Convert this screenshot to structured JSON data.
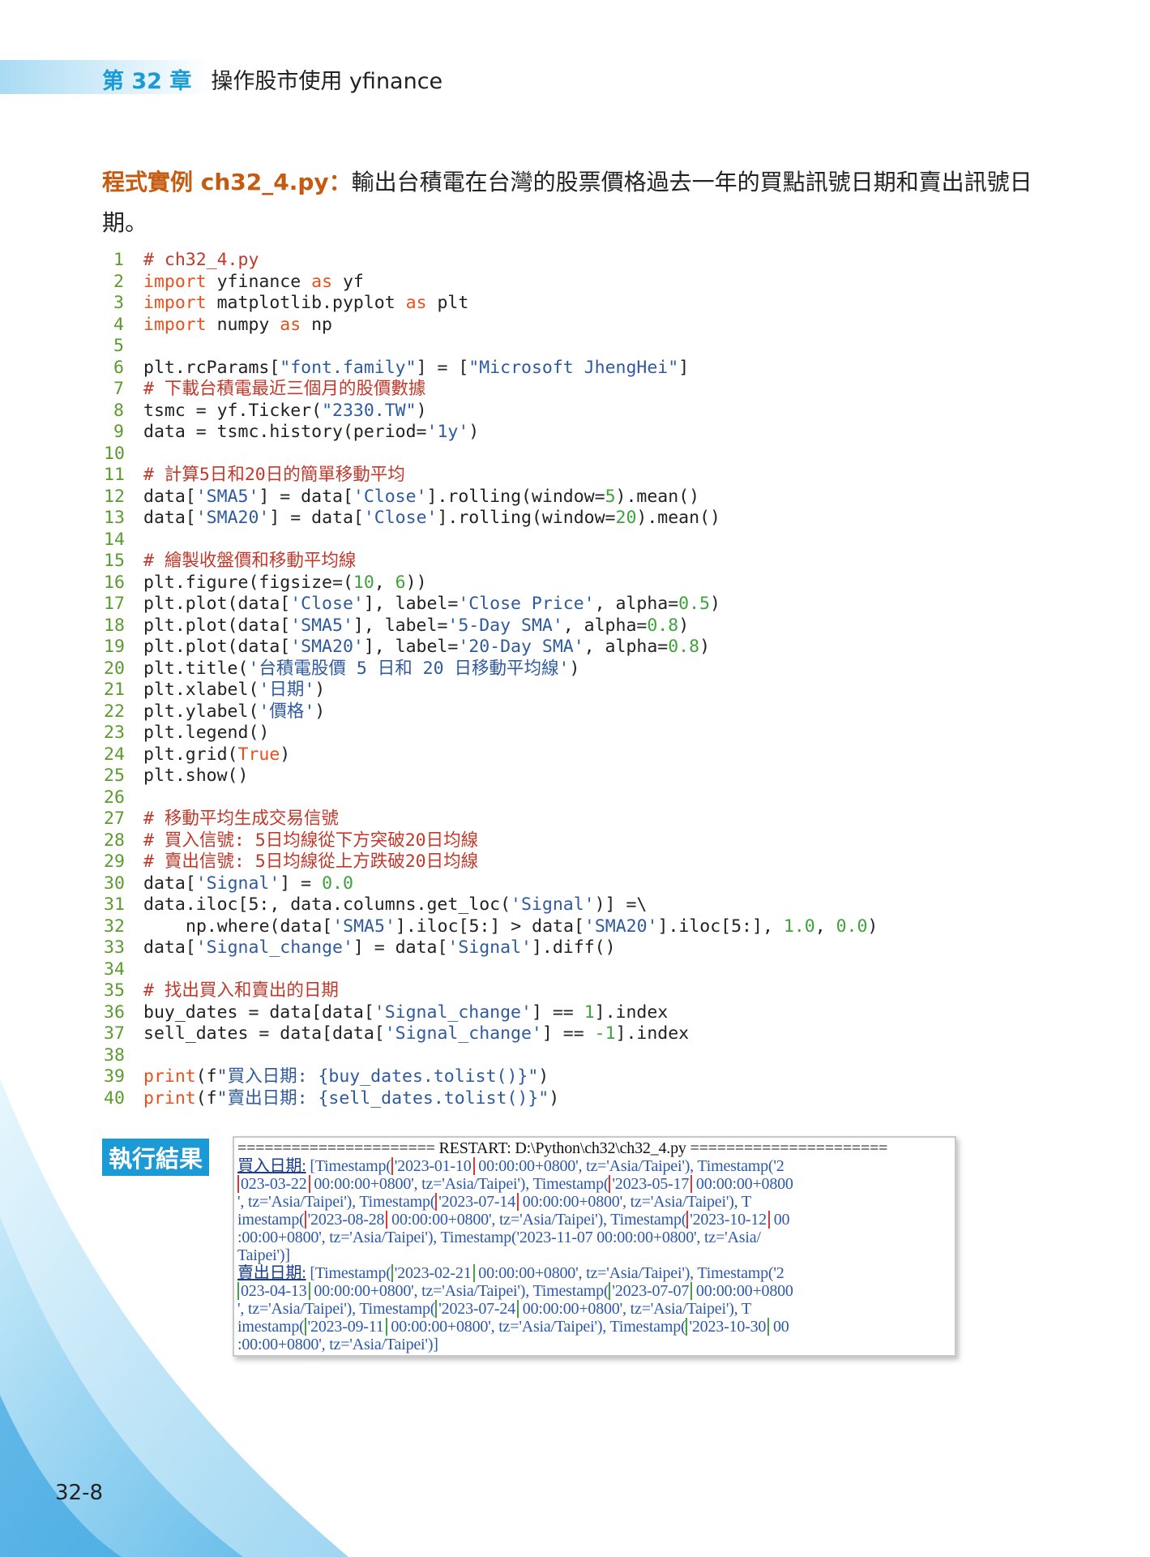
{
  "header": {
    "chapter_number": "第 32 章",
    "chapter_title": "操作股市使用 yfinance"
  },
  "intro": {
    "label": "程式實例 ch32_4.py：",
    "text": "輸出台積電在台灣的股票價格過去一年的買點訊號日期和賣出訊號日期。"
  },
  "code": {
    "lines": [
      {
        "n": "1",
        "segs": [
          {
            "t": "# ch32_4.py",
            "c": "cm"
          }
        ]
      },
      {
        "n": "2",
        "segs": [
          {
            "t": "import",
            "c": "kw"
          },
          {
            "t": " yfinance "
          },
          {
            "t": "as",
            "c": "kw"
          },
          {
            "t": " yf"
          }
        ]
      },
      {
        "n": "3",
        "segs": [
          {
            "t": "import",
            "c": "kw"
          },
          {
            "t": " matplotlib.pyplot "
          },
          {
            "t": "as",
            "c": "kw"
          },
          {
            "t": " plt"
          }
        ]
      },
      {
        "n": "4",
        "segs": [
          {
            "t": "import",
            "c": "kw"
          },
          {
            "t": " numpy "
          },
          {
            "t": "as",
            "c": "kw"
          },
          {
            "t": " np"
          }
        ]
      },
      {
        "n": "5",
        "segs": []
      },
      {
        "n": "6",
        "segs": [
          {
            "t": "plt.rcParams["
          },
          {
            "t": "\"font.family\"",
            "c": "str"
          },
          {
            "t": "] = ["
          },
          {
            "t": "\"Microsoft JhengHei\"",
            "c": "str"
          },
          {
            "t": "]"
          }
        ]
      },
      {
        "n": "7",
        "segs": [
          {
            "t": "# 下載台積電最近三個月的股價數據",
            "c": "cm"
          }
        ]
      },
      {
        "n": "8",
        "segs": [
          {
            "t": "tsmc = yf.Ticker("
          },
          {
            "t": "\"2330.TW\"",
            "c": "str"
          },
          {
            "t": ")"
          }
        ]
      },
      {
        "n": "9",
        "segs": [
          {
            "t": "data = tsmc.history(period="
          },
          {
            "t": "'1y'",
            "c": "str"
          },
          {
            "t": ")"
          }
        ]
      },
      {
        "n": "10",
        "segs": []
      },
      {
        "n": "11",
        "segs": [
          {
            "t": "# 計算5日和20日的簡單移動平均",
            "c": "cm"
          }
        ]
      },
      {
        "n": "12",
        "segs": [
          {
            "t": "data["
          },
          {
            "t": "'SMA5'",
            "c": "str"
          },
          {
            "t": "] = data["
          },
          {
            "t": "'Close'",
            "c": "str"
          },
          {
            "t": "].rolling(window="
          },
          {
            "t": "5",
            "c": "num"
          },
          {
            "t": ").mean()"
          }
        ]
      },
      {
        "n": "13",
        "segs": [
          {
            "t": "data["
          },
          {
            "t": "'SMA20'",
            "c": "str"
          },
          {
            "t": "] = data["
          },
          {
            "t": "'Close'",
            "c": "str"
          },
          {
            "t": "].rolling(window="
          },
          {
            "t": "20",
            "c": "num"
          },
          {
            "t": ").mean()"
          }
        ]
      },
      {
        "n": "14",
        "segs": []
      },
      {
        "n": "15",
        "segs": [
          {
            "t": "# 繪製收盤價和移動平均線",
            "c": "cm"
          }
        ]
      },
      {
        "n": "16",
        "segs": [
          {
            "t": "plt.figure(figsize=("
          },
          {
            "t": "10",
            "c": "num"
          },
          {
            "t": ", "
          },
          {
            "t": "6",
            "c": "num"
          },
          {
            "t": "))"
          }
        ]
      },
      {
        "n": "17",
        "segs": [
          {
            "t": "plt.plot(data["
          },
          {
            "t": "'Close'",
            "c": "str"
          },
          {
            "t": "], label="
          },
          {
            "t": "'Close Price'",
            "c": "str"
          },
          {
            "t": ", alpha="
          },
          {
            "t": "0.5",
            "c": "num"
          },
          {
            "t": ")"
          }
        ]
      },
      {
        "n": "18",
        "segs": [
          {
            "t": "plt.plot(data["
          },
          {
            "t": "'SMA5'",
            "c": "str"
          },
          {
            "t": "], label="
          },
          {
            "t": "'5-Day SMA'",
            "c": "str"
          },
          {
            "t": ", alpha="
          },
          {
            "t": "0.8",
            "c": "num"
          },
          {
            "t": ")"
          }
        ]
      },
      {
        "n": "19",
        "segs": [
          {
            "t": "plt.plot(data["
          },
          {
            "t": "'SMA20'",
            "c": "str"
          },
          {
            "t": "], label="
          },
          {
            "t": "'20-Day SMA'",
            "c": "str"
          },
          {
            "t": ", alpha="
          },
          {
            "t": "0.8",
            "c": "num"
          },
          {
            "t": ")"
          }
        ]
      },
      {
        "n": "20",
        "segs": [
          {
            "t": "plt.title("
          },
          {
            "t": "'台積電股價 5 日和 20 日移動平均線'",
            "c": "str"
          },
          {
            "t": ")"
          }
        ]
      },
      {
        "n": "21",
        "segs": [
          {
            "t": "plt.xlabel("
          },
          {
            "t": "'日期'",
            "c": "str"
          },
          {
            "t": ")"
          }
        ]
      },
      {
        "n": "22",
        "segs": [
          {
            "t": "plt.ylabel("
          },
          {
            "t": "'價格'",
            "c": "str"
          },
          {
            "t": ")"
          }
        ]
      },
      {
        "n": "23",
        "segs": [
          {
            "t": "plt.legend()"
          }
        ]
      },
      {
        "n": "24",
        "segs": [
          {
            "t": "plt.grid("
          },
          {
            "t": "True",
            "c": "kw"
          },
          {
            "t": ")"
          }
        ]
      },
      {
        "n": "25",
        "segs": [
          {
            "t": "plt.show()"
          }
        ]
      },
      {
        "n": "26",
        "segs": []
      },
      {
        "n": "27",
        "segs": [
          {
            "t": "# 移動平均生成交易信號",
            "c": "cm"
          }
        ]
      },
      {
        "n": "28",
        "segs": [
          {
            "t": "# 買入信號: 5日均線從下方突破20日均線",
            "c": "cm"
          }
        ]
      },
      {
        "n": "29",
        "segs": [
          {
            "t": "# 賣出信號: 5日均線從上方跌破20日均線",
            "c": "cm"
          }
        ]
      },
      {
        "n": "30",
        "segs": [
          {
            "t": "data["
          },
          {
            "t": "'Signal'",
            "c": "str"
          },
          {
            "t": "] = "
          },
          {
            "t": "0.0",
            "c": "num"
          }
        ]
      },
      {
        "n": "31",
        "segs": [
          {
            "t": "data.iloc[5:, data.columns.get_loc("
          },
          {
            "t": "'Signal'",
            "c": "str"
          },
          {
            "t": ")] =\\"
          }
        ]
      },
      {
        "n": "32",
        "indent": true,
        "segs": [
          {
            "t": "np.where(data["
          },
          {
            "t": "'SMA5'",
            "c": "str"
          },
          {
            "t": "].iloc[5:] > data["
          },
          {
            "t": "'SMA20'",
            "c": "str"
          },
          {
            "t": "].iloc[5:], "
          },
          {
            "t": "1.0",
            "c": "num"
          },
          {
            "t": ", "
          },
          {
            "t": "0.0",
            "c": "num"
          },
          {
            "t": ")"
          }
        ]
      },
      {
        "n": "33",
        "segs": [
          {
            "t": "data["
          },
          {
            "t": "'Signal_change'",
            "c": "str"
          },
          {
            "t": "] = data["
          },
          {
            "t": "'Signal'",
            "c": "str"
          },
          {
            "t": "].diff()"
          }
        ]
      },
      {
        "n": "34",
        "segs": []
      },
      {
        "n": "35",
        "segs": [
          {
            "t": "# 找出買入和賣出的日期",
            "c": "cm"
          }
        ]
      },
      {
        "n": "36",
        "segs": [
          {
            "t": "buy_dates = data[data["
          },
          {
            "t": "'Signal_change'",
            "c": "str"
          },
          {
            "t": "] == "
          },
          {
            "t": "1",
            "c": "num"
          },
          {
            "t": "].index"
          }
        ]
      },
      {
        "n": "37",
        "segs": [
          {
            "t": "sell_dates = data[data["
          },
          {
            "t": "'Signal_change'",
            "c": "str"
          },
          {
            "t": "] == "
          },
          {
            "t": "-1",
            "c": "num"
          },
          {
            "t": "].index"
          }
        ]
      },
      {
        "n": "38",
        "segs": []
      },
      {
        "n": "39",
        "segs": [
          {
            "t": "print",
            "c": "kw"
          },
          {
            "t": "(f"
          },
          {
            "t": "\"買入日期: {buy_dates.tolist()}\"",
            "c": "str"
          },
          {
            "t": ")"
          }
        ]
      },
      {
        "n": "40",
        "segs": [
          {
            "t": "print",
            "c": "kw"
          },
          {
            "t": "(f"
          },
          {
            "t": "\"賣出日期: {sell_dates.tolist()}\"",
            "c": "str"
          },
          {
            "t": ")"
          }
        ]
      }
    ]
  },
  "result": {
    "label": "執行結果",
    "lines": [
      [
        {
          "t": "====================== RESTART: D:\\Python\\ch32\\ch32_4.py ======================",
          "c": "restart"
        }
      ],
      [
        {
          "t": "買入日期:",
          "c": "lbl2"
        },
        {
          "t": " [Timestamp("
        },
        {
          "t": "'2023-01-10",
          "c": "box-r"
        },
        {
          "t": " 00:00:00+0800', tz='Asia/Taipei'), Timestamp('2"
        }
      ],
      [
        {
          "t": "023-03-22",
          "c": "box-r"
        },
        {
          "t": " 00:00:00+0800', tz='Asia/Taipei'), Timestamp("
        },
        {
          "t": "'2023-05-17",
          "c": "box-r"
        },
        {
          "t": " 00:00:00+0800"
        }
      ],
      [
        {
          "t": "', tz='Asia/Taipei'), Timestamp("
        },
        {
          "t": "'2023-07-14",
          "c": "box-r"
        },
        {
          "t": " 00:00:00+0800', tz='Asia/Taipei'), T"
        }
      ],
      [
        {
          "t": "imestamp("
        },
        {
          "t": "'2023-08-28",
          "c": "box-r"
        },
        {
          "t": " 00:00:00+0800', tz='Asia/Taipei'), Timestamp("
        },
        {
          "t": "'2023-10-12",
          "c": "box-r"
        },
        {
          "t": " 00"
        }
      ],
      [
        {
          "t": ":00:00+0800', tz='Asia/Taipei'), Timestamp('2023-11-07 00:00:00+0800', tz='Asia/"
        }
      ],
      [
        {
          "t": "Taipei')]"
        }
      ],
      [
        {
          "t": "賣出日期:",
          "c": "lbl2"
        },
        {
          "t": " [Timestamp("
        },
        {
          "t": "'2023-02-21",
          "c": "box-g"
        },
        {
          "t": " 00:00:00+0800', tz='Asia/Taipei'), Timestamp('2"
        }
      ],
      [
        {
          "t": "023-04-13",
          "c": "box-g"
        },
        {
          "t": " 00:00:00+0800', tz='Asia/Taipei'), Timestamp("
        },
        {
          "t": "'2023-07-07",
          "c": "box-g"
        },
        {
          "t": " 00:00:00+0800"
        }
      ],
      [
        {
          "t": "', tz='Asia/Taipei'), Timestamp("
        },
        {
          "t": "'2023-07-24",
          "c": "box-g"
        },
        {
          "t": " 00:00:00+0800', tz='Asia/Taipei'), T"
        }
      ],
      [
        {
          "t": "imestamp("
        },
        {
          "t": "'2023-09-11",
          "c": "box-g"
        },
        {
          "t": " 00:00:00+0800', tz='Asia/Taipei'), Timestamp("
        },
        {
          "t": "'2023-10-30",
          "c": "box-g"
        },
        {
          "t": " 00"
        }
      ],
      [
        {
          "t": ":00:00+0800', tz='Asia/Taipei')]"
        }
      ]
    ]
  },
  "footer": {
    "page_number": "32-8"
  }
}
